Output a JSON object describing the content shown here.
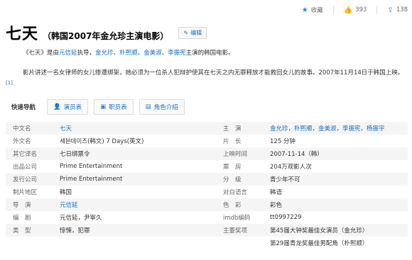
{
  "toolbar": {
    "favorite_label": "收藏",
    "likes": "393",
    "shares": "138"
  },
  "header": {
    "title": "七天",
    "subtitle": "（韩国2007年金允珍主演电影）",
    "edit_label": "编辑"
  },
  "intro": {
    "p1_parts": [
      "《七天》是由",
      "元信延",
      "执导，",
      "金允珍",
      "、",
      "朴熙顺",
      "、",
      "金美淑",
      "、",
      "李振宪",
      "主演的韩国电影。"
    ],
    "p2": "影片讲述一名女律师的女儿惨遭绑架，她必须为一位杀人犯辩护使其在七天之内无罪释放才能救回女儿的故事。2007年11月14日于韩国上映。",
    "ref": "[1]"
  },
  "quicknav": {
    "label": "快速导航",
    "buttons": [
      "演员表",
      "职员表",
      "角色介绍"
    ]
  },
  "info": {
    "rows": [
      {
        "k1": "中文名",
        "v1": "七天",
        "k2": "主　演",
        "v2": "金允珍，朴熙顺，金美淑，李振宪，杨振宇",
        "v1link": true,
        "v2link": true
      },
      {
        "k1": "外文名",
        "v1": "세븐데이즈(韩文)  7 Days(英文)",
        "k2": "片　长",
        "v2": "125 分钟"
      },
      {
        "k1": "其它译名",
        "v1": "七日绑票令",
        "k2": "上映时间",
        "v2": "2007-11-14（韩）"
      },
      {
        "k1": "出品公司",
        "v1": "Prime Entertainment",
        "k2": "票　房",
        "v2": "204万观影人次"
      },
      {
        "k1": "发行公司",
        "v1": "Prime Entertainment",
        "k2": "分　级",
        "v2": "青少年不可"
      },
      {
        "k1": "制片地区",
        "v1": "韩国",
        "k2": "对白语言",
        "v2": "韩语"
      },
      {
        "k1": "导　演",
        "v1": "元信延",
        "k2": "色　彩",
        "v2": "彩色",
        "v1link": true
      },
      {
        "k1": "编　剧",
        "v1": "元信延，尹宰久",
        "k2": "imdb编码",
        "v2": "tt0997229"
      },
      {
        "k1": "类　型",
        "v1": "惊悚，犯罪",
        "k2": "主要奖项",
        "v2": "第45届大钟奖最佳女演员（金允珍）"
      },
      {
        "k1": "",
        "v1": "",
        "k2": "",
        "v2": "第29届青龙奖最佳男配角（朴熙顺）"
      }
    ]
  }
}
